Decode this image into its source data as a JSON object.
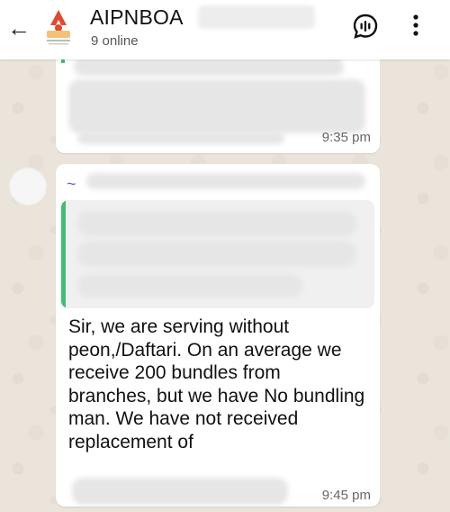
{
  "header": {
    "title": "AIPNBOA",
    "status": "9 online",
    "icons": {
      "back": "arrow-left-icon",
      "voice_chat": "voice-chat-icon",
      "menu": "more-vertical-icon"
    }
  },
  "messages": [
    {
      "time": "9:35 pm"
    },
    {
      "text": "Sir, we are serving without peon,/Daftari. On an average we receive 200 bundles from branches, but we have No bundling man. We have not received replacement of",
      "time": "9:45 pm"
    }
  ]
}
